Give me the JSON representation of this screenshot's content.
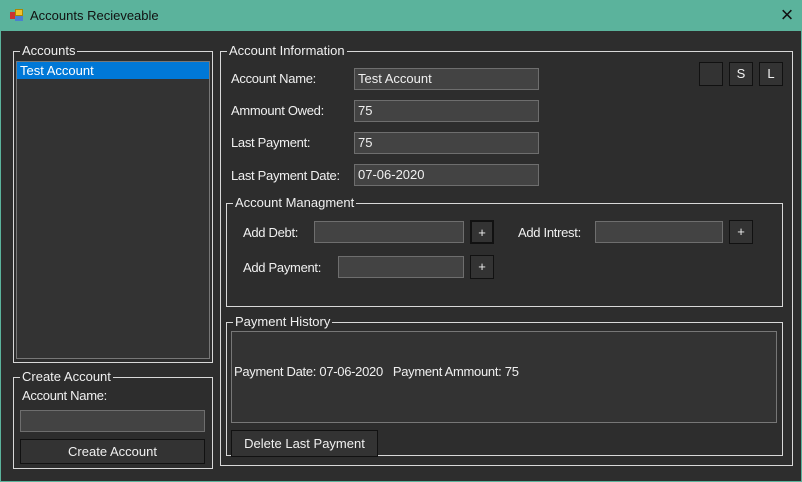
{
  "window": {
    "title": "Accounts Recieveable",
    "close_icon": "×"
  },
  "accounts": {
    "legend": "Accounts",
    "items": [
      "Test Account"
    ]
  },
  "create": {
    "legend": "Create Account",
    "name_label": "Account Name:",
    "name_value": "",
    "button": "Create Account"
  },
  "info": {
    "legend": "Account Information",
    "name_label": "Account Name:",
    "name_value": "Test Account",
    "owed_label": "Ammount Owed:",
    "owed_value": "75",
    "last_label": "Last Payment:",
    "last_value": "75",
    "date_label": "Last Payment Date:",
    "date_value": "07-06-2020",
    "btn1": "",
    "btn_s": "S",
    "btn_l": "L"
  },
  "manage": {
    "legend": "Account Managment",
    "debt_label": "Add Debt:",
    "interest_label": "Add Intrest:",
    "payment_label": "Add Payment:",
    "plus": "+"
  },
  "history": {
    "legend": "Payment History",
    "entries": [
      "Payment Date: 07-06-2020   Payment Ammount: 75"
    ],
    "delete_button": "Delete Last Payment"
  }
}
